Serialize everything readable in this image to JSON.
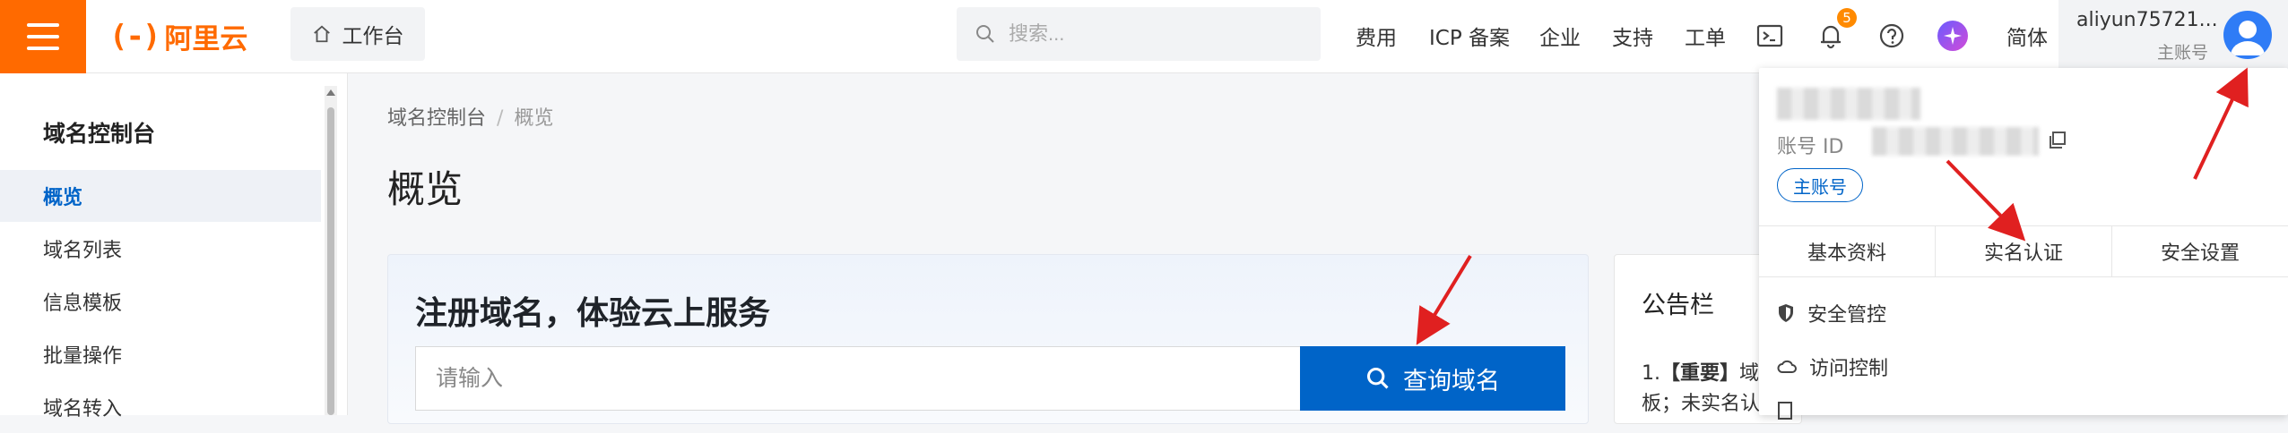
{
  "topbar": {
    "logo_mark": "(-)",
    "logo_text": "阿里云",
    "workbench_label": "工作台",
    "search_placeholder": "搜索...",
    "nav": {
      "fees": "费用",
      "icp": "ICP 备案",
      "enterprise": "企业",
      "support": "支持",
      "tickets": "工单",
      "language": "简体"
    },
    "notification_count": "5",
    "user_name": "aliyun75721...",
    "user_role": "主账号"
  },
  "sidebar": {
    "title": "域名控制台",
    "items": [
      {
        "label": "概览",
        "active": true
      },
      {
        "label": "域名列表",
        "active": false
      },
      {
        "label": "信息模板",
        "active": false
      },
      {
        "label": "批量操作",
        "active": false
      },
      {
        "label": "域名转入",
        "active": false
      }
    ]
  },
  "main": {
    "breadcrumb": [
      "域名控制台",
      "概览"
    ],
    "page_title": "概览",
    "hero_title": "注册域名，体验云上服务",
    "hero_input_placeholder": "请输入",
    "hero_button": "查询域名",
    "notice_title": "公告栏",
    "notice_line1_prefix": "1.",
    "notice_line1_bold": "【重要】",
    "notice_line1_rest": "域",
    "notice_line2": "板；未实名认"
  },
  "account_dropdown": {
    "account_id_label": "账号 ID",
    "main_account_tag": "主账号",
    "tabs": [
      "基本资料",
      "实名认证",
      "安全设置"
    ],
    "menu": [
      "安全管控",
      "访问控制"
    ]
  },
  "colors": {
    "brand": "#ff6a00",
    "primary": "#0064c8",
    "annotation_arrow": "#e02020"
  }
}
